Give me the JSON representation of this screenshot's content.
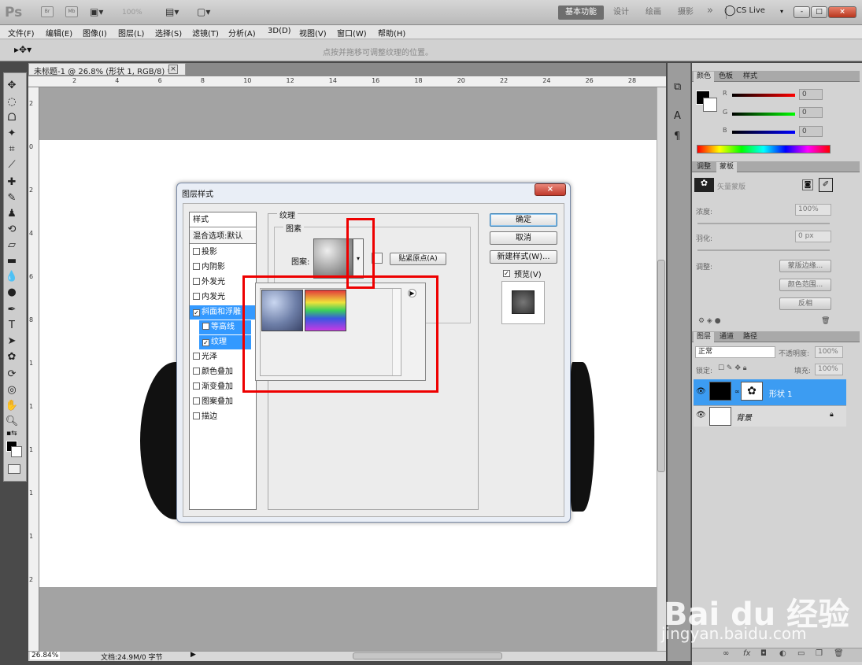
{
  "app": {
    "logo": "Ps",
    "bridge": "Br",
    "minibridge": "Mb",
    "zoom": "100%",
    "workspaces": [
      "基本功能",
      "设计",
      "绘画",
      "摄影"
    ],
    "more": "»",
    "cslive": "CS Live",
    "window_controls": [
      "-",
      "□",
      "×"
    ]
  },
  "menu": [
    "文件(F)",
    "编辑(E)",
    "图像(I)",
    "图层(L)",
    "选择(S)",
    "滤镜(T)",
    "分析(A)",
    "3D(D)",
    "视图(V)",
    "窗口(W)",
    "帮助(H)"
  ],
  "options_hint": "点按并拖移可调整纹理的位置。",
  "document": {
    "tab_title": "未标题-1 @ 26.8% (形状 1, RGB/8) *",
    "tab_close": "×",
    "ruler_h": [
      "2",
      "4",
      "6",
      "8",
      "10",
      "12",
      "14",
      "16",
      "18",
      "20",
      "22",
      "24",
      "26",
      "28"
    ],
    "ruler_v": [
      "2",
      "0",
      "2",
      "4",
      "6",
      "8",
      "1",
      "1",
      "1",
      "1",
      "1",
      "2"
    ],
    "zoom_percent": "26.84%",
    "doc_info": "文档:24.9M/0 字节"
  },
  "panels": {
    "color_tabs": [
      "颜色",
      "色板",
      "样式"
    ],
    "channels": [
      "R",
      "G",
      "B"
    ],
    "channel_values": [
      "0",
      "0",
      "0"
    ],
    "adjust_tabs": [
      "调整",
      "蒙板"
    ],
    "mask_title": "矢量蒙版",
    "density_label": "浓度:",
    "density_value": "100%",
    "feather_label": "羽化:",
    "feather_value": "0 px",
    "refine_label": "调整:",
    "mask_buttons": [
      "蒙版边缘...",
      "颜色范围...",
      "反相"
    ],
    "layer_tabs": [
      "图层",
      "通道",
      "路径"
    ],
    "blend_mode": "正常",
    "opacity_label": "不透明度:",
    "opacity_value": "100%",
    "lock_label": "锁定:",
    "fill_label": "填充:",
    "fill_value": "100%",
    "layers": [
      {
        "name": "形状 1",
        "selected": true
      },
      {
        "name": "背景",
        "selected": false
      }
    ]
  },
  "dialog": {
    "title": "图层样式",
    "close": "×",
    "styles_header": "样式",
    "blend_options": "混合选项:默认",
    "style_items": [
      {
        "label": "投影",
        "checked": false
      },
      {
        "label": "内阴影",
        "checked": false
      },
      {
        "label": "外发光",
        "checked": false
      },
      {
        "label": "内发光",
        "checked": false
      },
      {
        "label": "斜面和浮雕",
        "checked": true
      },
      {
        "label": "等高线",
        "checked": false
      },
      {
        "label": "纹理",
        "checked": true
      },
      {
        "label": "光泽",
        "checked": false
      },
      {
        "label": "颜色叠加",
        "checked": false
      },
      {
        "label": "渐变叠加",
        "checked": false
      },
      {
        "label": "图案叠加",
        "checked": false
      },
      {
        "label": "描边",
        "checked": false
      }
    ],
    "texture_legend": "纹理",
    "pattern_legend": "图素",
    "pattern_label": "图案:",
    "snap_button": "贴紧原点(A)",
    "ok_button": "确定",
    "cancel_button": "取消",
    "new_style_button": "新建样式(W)...",
    "preview_label": "预览(V)",
    "preview_checked": true
  },
  "watermark": {
    "line1": "Bai du 经验",
    "line2": "jingyan.baidu.com"
  }
}
